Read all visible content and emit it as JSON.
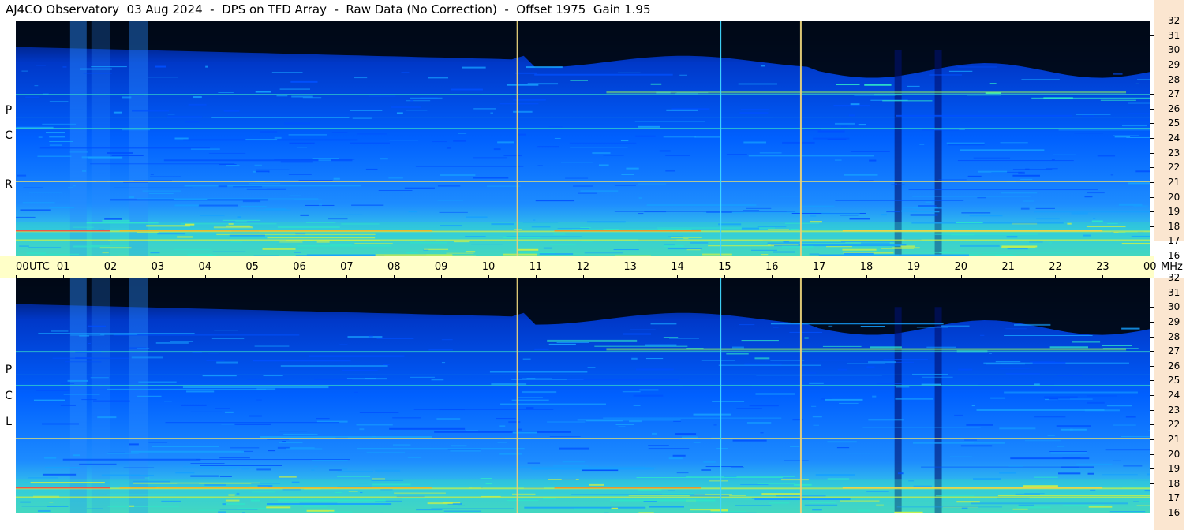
{
  "chart_data": {
    "type": "heatmap",
    "title": "AJ4CO Observatory  03 Aug 2024  -  DPS on TFD Array  -  Raw Data (No Correction)  -  Offset 1975  Gain 1.95",
    "x_ticks": [
      "00",
      "01",
      "02",
      "03",
      "04",
      "05",
      "06",
      "07",
      "08",
      "09",
      "10",
      "11",
      "12",
      "13",
      "14",
      "15",
      "16",
      "17",
      "18",
      "19",
      "20",
      "21",
      "22",
      "23",
      "00"
    ],
    "x_unit": "UTC",
    "y_unit": "MHz",
    "y_ticks": [
      "32",
      "31",
      "30",
      "29",
      "28",
      "27",
      "26",
      "25",
      "24",
      "23",
      "22",
      "21",
      "20",
      "19",
      "18",
      "17",
      "16"
    ],
    "xlim": [
      0,
      24
    ],
    "ylim": [
      16,
      32
    ],
    "panels": [
      {
        "label": [
          "R",
          "C",
          "P"
        ],
        "name": "RCP"
      },
      {
        "label": [
          "L",
          "C",
          "P"
        ],
        "name": "LCP"
      }
    ],
    "vertical_markers_utc": [
      10.6,
      14.9,
      16.6
    ],
    "strong_lines_mhz": [
      17.7,
      17.1,
      21.1,
      27.0,
      24.7,
      25.4
    ],
    "colormap": [
      "#000814",
      "#002a8f",
      "#0050ff",
      "#16a0ff",
      "#2ee6c8",
      "#c8f04a",
      "#ffb020",
      "#ff3030",
      "#ffffff"
    ]
  },
  "colors": {
    "panel_bg": "#0a0a1a",
    "xaxis_bg": "#ffffc8",
    "yaxis_bg": "#fbe6d0",
    "marker": "#e8d27a"
  }
}
